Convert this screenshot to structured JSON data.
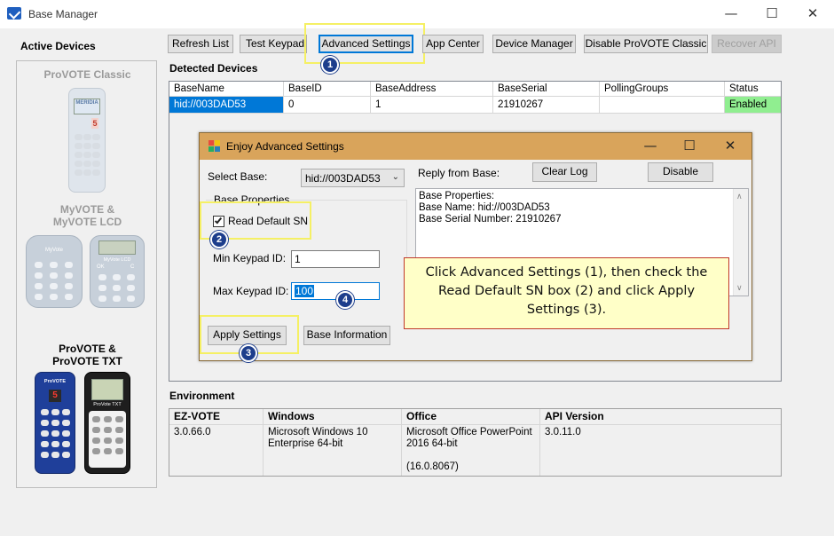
{
  "window": {
    "title": "Base Manager",
    "controls": {
      "minimize": "—",
      "maximize": "☐",
      "close": "✕"
    }
  },
  "sidebar": {
    "heading": "Active Devices",
    "devices": [
      {
        "label": "ProVOTE Classic",
        "active": false
      },
      {
        "label": "MyVOTE &\nMyVOTE LCD",
        "active": false
      },
      {
        "label": "ProVOTE &\nProVOTE TXT",
        "active": true
      }
    ],
    "device_labels": {
      "provote_classic": "ProVOTE Classic",
      "myvote_line1": "MyVOTE &",
      "myvote_line2": "MyVOTE LCD",
      "provote_line1": "ProVOTE &",
      "provote_line2": "ProVOTE TXT"
    }
  },
  "toolbar": {
    "refresh": "Refresh List",
    "test_keypads": "Test Keypads",
    "advanced_settings": "Advanced Settings",
    "app_center": "App Center",
    "device_manager": "Device Manager",
    "disable_classic": "Disable ProVOTE Classic",
    "recover_api": "Recover API"
  },
  "detected": {
    "heading": "Detected Devices",
    "columns": [
      "BaseName",
      "BaseID",
      "BaseAddress",
      "BaseSerial",
      "PollingGroups",
      "Status"
    ],
    "rows": [
      {
        "name": "hid://003DAD53",
        "id": "0",
        "address": "1",
        "serial": "21910267",
        "polling": "",
        "status": "Enabled"
      }
    ]
  },
  "dialog": {
    "title": "Enjoy Advanced Settings",
    "select_base_label": "Select Base:",
    "select_base_value": "hid://003DAD53",
    "base_properties_group": "Base Properties",
    "read_default_sn_label": "Read Default SN",
    "read_default_sn_checked": true,
    "min_keypad_label": "Min Keypad ID:",
    "min_keypad_value": "1",
    "max_keypad_label": "Max Keypad ID:",
    "max_keypad_value": "100",
    "apply_settings": "Apply Settings",
    "base_information": "Base Information",
    "reply_label": "Reply from Base:",
    "clear_log": "Clear Log",
    "disable": "Disable",
    "reply_lines": [
      "Base Properties:",
      "Base Name: hid://003DAD53",
      "Base Serial Number: 21910267"
    ]
  },
  "callout": {
    "text": "Click Advanced Settings (1), then check the Read Default SN box (2) and click Apply Settings (3)."
  },
  "badges": {
    "one": "1",
    "two": "2",
    "three": "3",
    "four": "4"
  },
  "environment": {
    "heading": "Environment",
    "columns": [
      "EZ-VOTE",
      "Windows",
      "Office",
      "API Version"
    ],
    "values": [
      "3.0.66.0",
      "Microsoft Windows 10\nEnterprise 64-bit",
      "Microsoft Office PowerPoint\n2016 64-bit\n\n(16.0.8067)",
      "3.0.11.0"
    ]
  },
  "colors": {
    "highlight": "#f5f064",
    "badge": "#1d3e8c",
    "selected_row": "#0078d7",
    "enabled_status": "#90ee90",
    "dialog_title": "#d9a45b",
    "callout_bg": "#ffffc8",
    "callout_border": "#c0392b"
  },
  "device_face_text": {
    "classic_brand": "MERIDIA",
    "classic_digit": "5",
    "myvote_brand": "MyVote",
    "myvote_lcd_brand": "MyVote LCD",
    "myvote_lcd_ok": "OK",
    "myvote_lcd_c": "C",
    "provote_brand": "ProVOTE",
    "provote_digit": "5",
    "provote_txt_brand": "ProVote TXT"
  }
}
